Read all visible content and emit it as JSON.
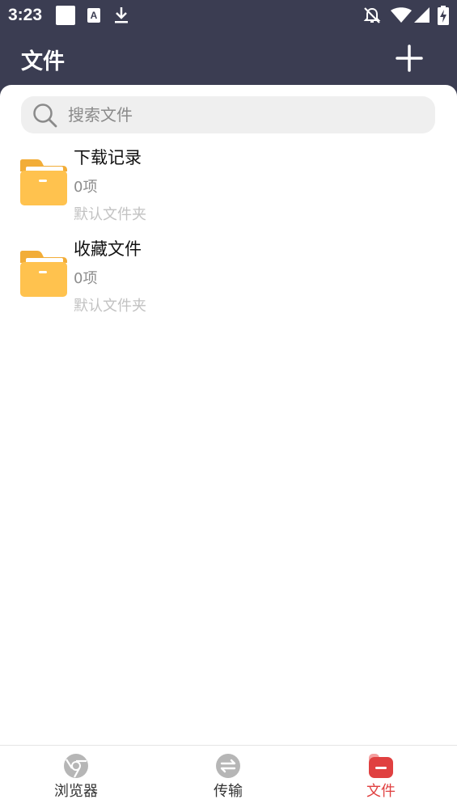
{
  "status_bar": {
    "time": "3:23",
    "icons": [
      "white-square-icon",
      "a-keyboard-icon",
      "download-icon",
      "bell-off-icon",
      "wifi-icon",
      "signal-icon",
      "battery-charging-icon"
    ]
  },
  "header": {
    "title": "文件",
    "add_icon": "plus-icon"
  },
  "search": {
    "placeholder": "搜索文件",
    "icon": "search-icon"
  },
  "folders": [
    {
      "name": "下载记录",
      "count": "0项",
      "desc": "默认文件夹",
      "icon": "folder-icon"
    },
    {
      "name": "收藏文件",
      "count": "0项",
      "desc": "默认文件夹",
      "icon": "folder-icon"
    }
  ],
  "nav": [
    {
      "label": "浏览器",
      "icon": "browser-icon",
      "active": false
    },
    {
      "label": "传输",
      "icon": "transfer-icon",
      "active": false
    },
    {
      "label": "文件",
      "icon": "files-icon",
      "active": true
    }
  ],
  "colors": {
    "header_bg": "#3b3d52",
    "accent": "#e04040",
    "folder": "#ffc24e"
  }
}
